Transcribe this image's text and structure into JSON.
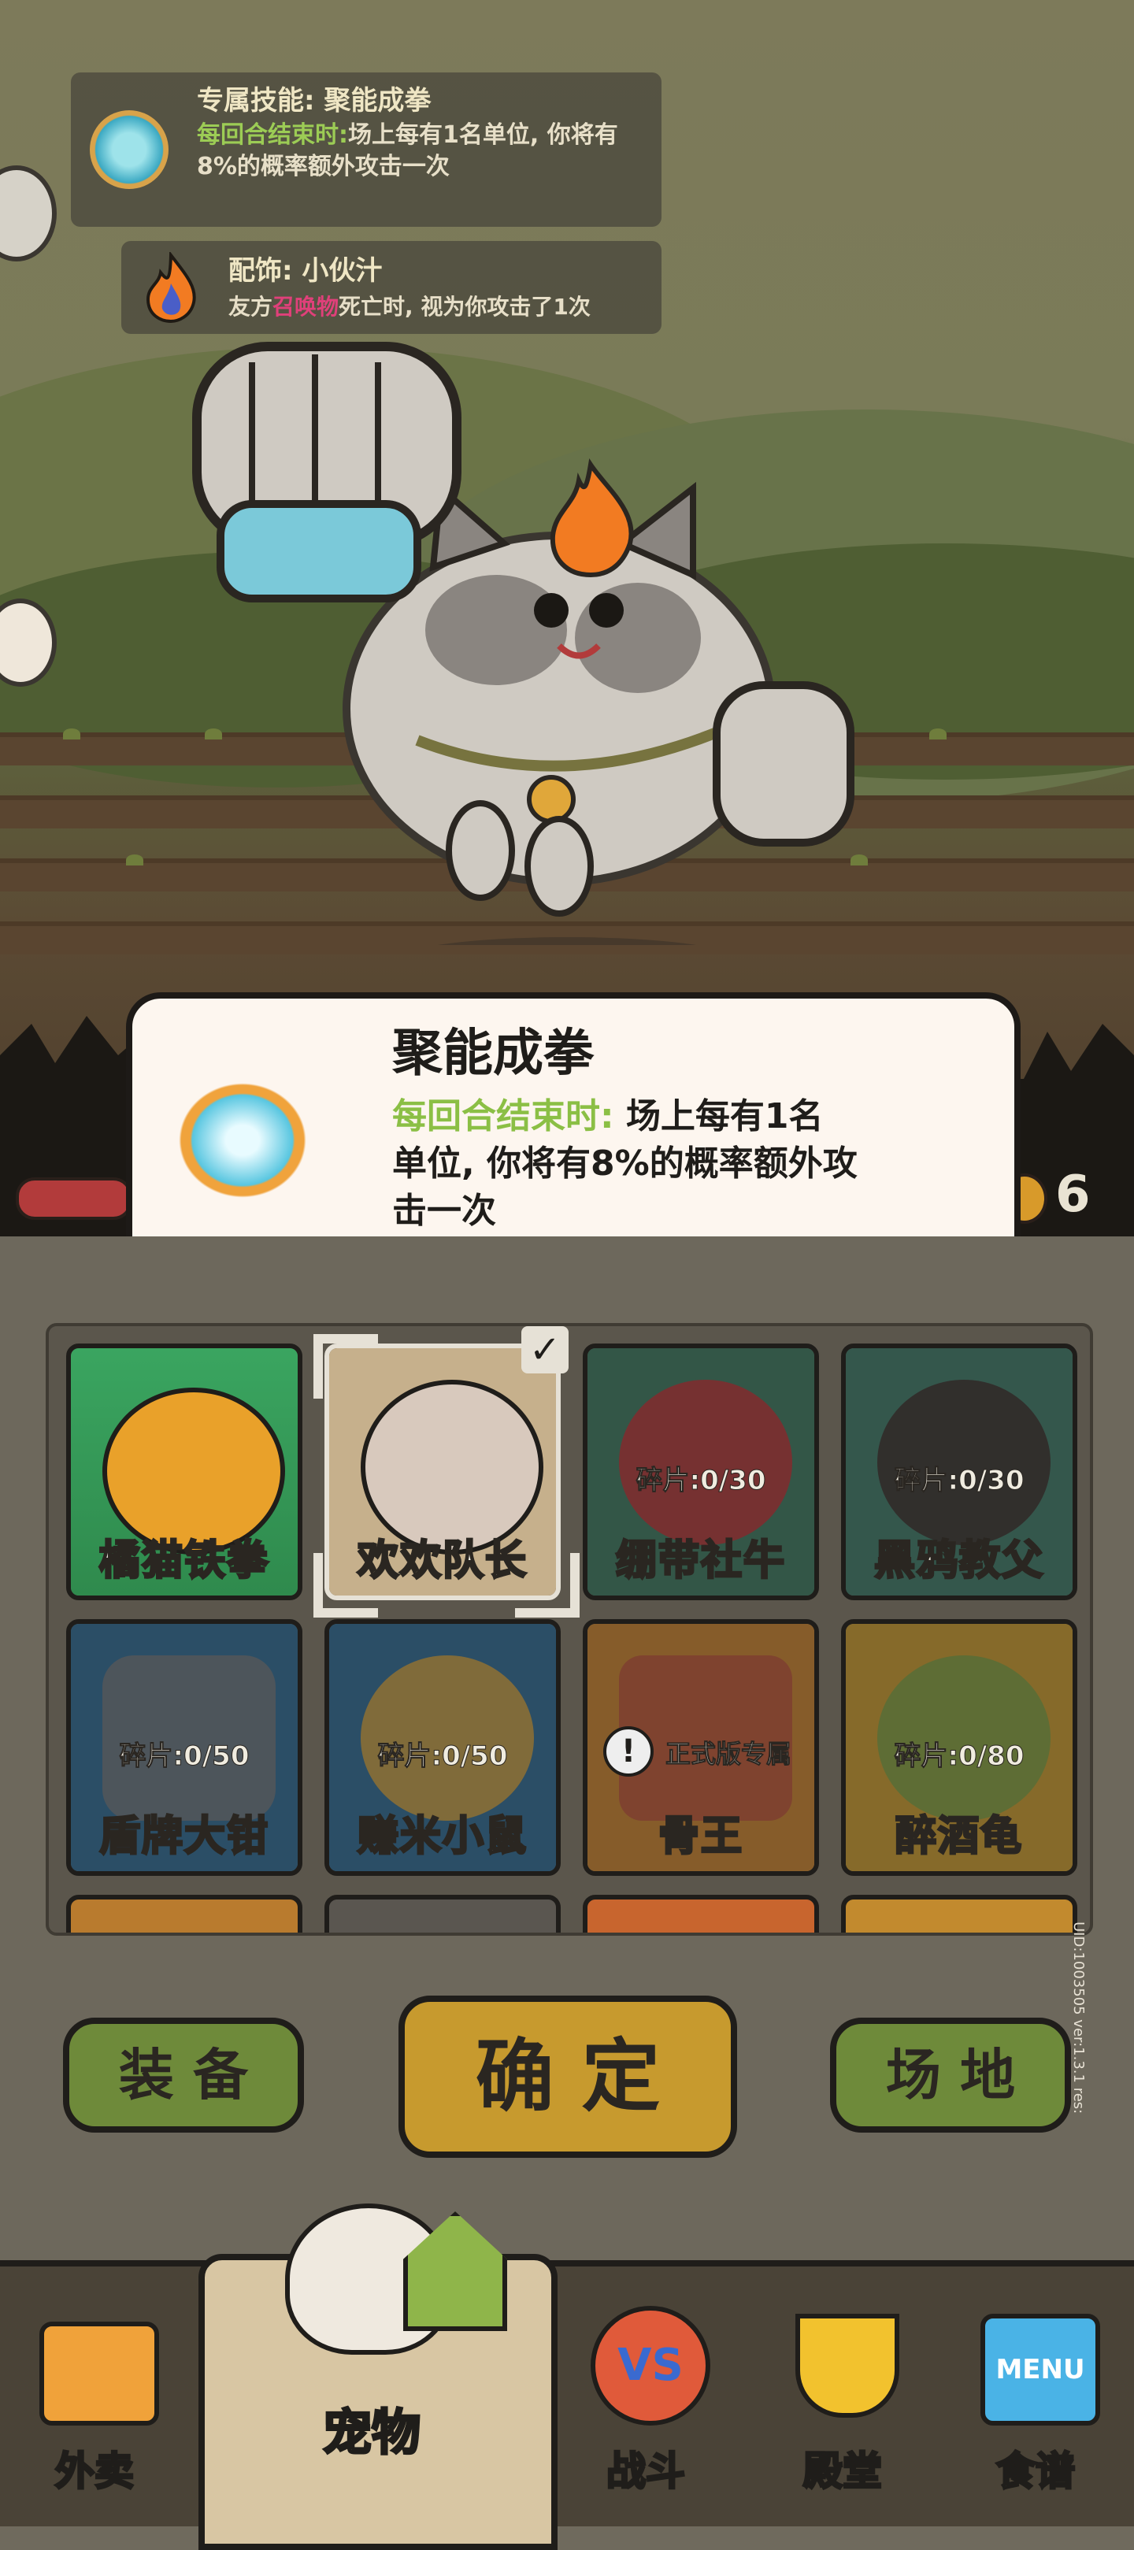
{
  "skill_panel": {
    "title": "专属技能: 聚能成拳",
    "timing": "每回合结束时:",
    "text": "场上每有1名单位, 你将有8%的概率额外攻击一次"
  },
  "accessory_panel": {
    "title": "配饰: 小伙汁",
    "text_pre": "友方",
    "text_highlight": "召唤物",
    "text_post": "死亡时, 视为你攻击了1次"
  },
  "tooltip": {
    "title": "聚能成拳",
    "timing": "每回合结束时:",
    "line1": "场上每有1名",
    "line2": "单位, 你将有8%的概率额外攻",
    "line3": "击一次"
  },
  "coin_count": "6",
  "pets": [
    {
      "name": "橘猫铁拳",
      "fragments": "",
      "color": "#e9a12a"
    },
    {
      "name": "欢欢队长",
      "fragments": "",
      "color": "#d8c9bd"
    },
    {
      "name": "绷带社牛",
      "fragments": "碎片:0/30",
      "color": "#b73a3a"
    },
    {
      "name": "黑鸦教父",
      "fragments": "碎片:0/30",
      "color": "#3f7e6b"
    },
    {
      "name": "盾牌大钳",
      "fragments": "碎片:0/50",
      "color": "#2f6e9a"
    },
    {
      "name": "赚米小鼠",
      "fragments": "碎片:0/50",
      "color": "#2f6e9a"
    },
    {
      "name": "骨王",
      "fragments": "正式版专属",
      "color": "#d3872c"
    },
    {
      "name": "醉酒龟",
      "fragments": "碎片:0/80",
      "color": "#d3a12c"
    }
  ],
  "buttons": {
    "equip": "装 备",
    "confirm": "确 定",
    "field": "场 地"
  },
  "nav": [
    {
      "label": "外卖",
      "icon": "takeout-box-icon"
    },
    {
      "label": "宠物",
      "icon": "pet-cat-icon"
    },
    {
      "label": "战斗",
      "icon": "versus-battle-icon"
    },
    {
      "label": "殿堂",
      "icon": "trophy-icon"
    },
    {
      "label": "食谱",
      "icon": "menu-book-icon"
    }
  ],
  "version_text": "UID:1003505 ver:1.3.1 res:",
  "colors": {
    "green_button": "#6e8a3a",
    "confirm_button": "#c79a2e",
    "highlight_green": "#8bbf45"
  }
}
